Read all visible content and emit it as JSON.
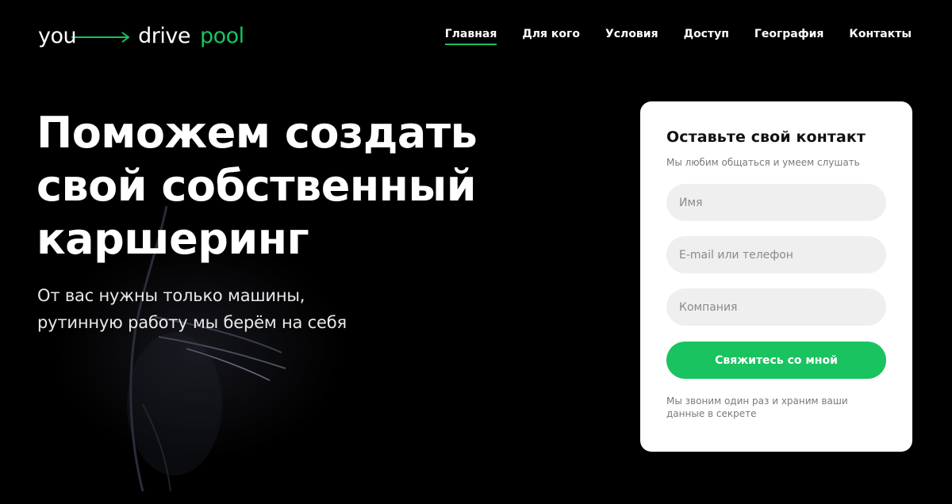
{
  "header": {
    "logo": {
      "part1": "you",
      "part2": "drive",
      "part3": "pool"
    },
    "nav": [
      {
        "label": "Главная",
        "active": true
      },
      {
        "label": "Для кого",
        "active": false
      },
      {
        "label": "Условия",
        "active": false
      },
      {
        "label": "Доступ",
        "active": false
      },
      {
        "label": "География",
        "active": false
      },
      {
        "label": "Контакты",
        "active": false
      }
    ]
  },
  "hero": {
    "title_lines": [
      "Поможем создать",
      "свой собственный",
      "каршеринг"
    ],
    "subtitle_lines": [
      "От вас нужны только машины,",
      "рутинную работу мы берём на себя"
    ]
  },
  "form": {
    "title": "Оставьте свой контакт",
    "subtitle": "Мы любим общаться и умеем слушать",
    "name_placeholder": "Имя",
    "contact_placeholder": "E-mail или телефон",
    "company_placeholder": "Компания",
    "submit_label": "Свяжитесь со мной",
    "note": "Мы звоним один раз и храним ваши данные в секрете"
  },
  "colors": {
    "background": "#000000",
    "accent": "#19c35f",
    "card": "#ffffff",
    "field": "#efefef"
  }
}
